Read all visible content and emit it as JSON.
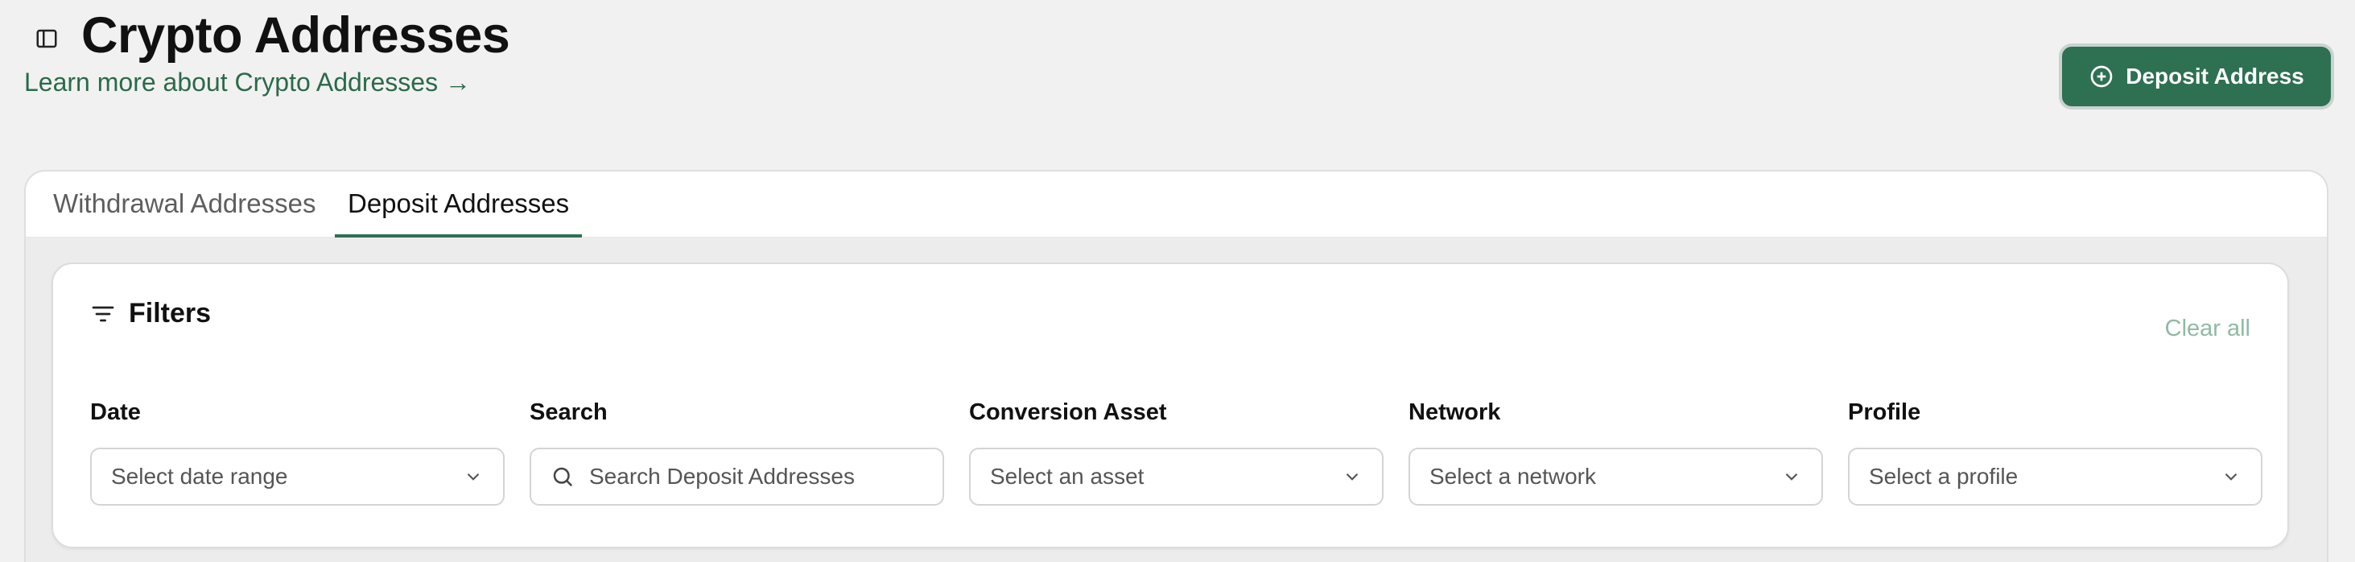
{
  "header": {
    "title": "Crypto Addresses",
    "learn_more": "Learn more about Crypto Addresses →",
    "deposit_button": "Deposit Address",
    "icons": {
      "sidebar_toggle": "sidebar-toggle-icon",
      "plus_circle": "plus-circle-icon"
    }
  },
  "tabs": [
    {
      "label": "Withdrawal Addresses",
      "active": false
    },
    {
      "label": "Deposit Addresses",
      "active": true
    }
  ],
  "filters": {
    "title": "Filters",
    "clear_all": "Clear all",
    "icon": "filter-lines-icon",
    "fields": {
      "date": {
        "label": "Date",
        "placeholder": "Select date range"
      },
      "search": {
        "label": "Search",
        "placeholder": "Search Deposit Addresses"
      },
      "asset": {
        "label": "Conversion Asset",
        "placeholder": "Select an asset"
      },
      "network": {
        "label": "Network",
        "placeholder": "Select a network"
      },
      "profile": {
        "label": "Profile",
        "placeholder": "Select a profile"
      }
    }
  },
  "colors": {
    "accent": "#2e7052",
    "link": "#2b6a49",
    "clear_all": "#8fbaa4",
    "background": "#f1f1f1"
  }
}
